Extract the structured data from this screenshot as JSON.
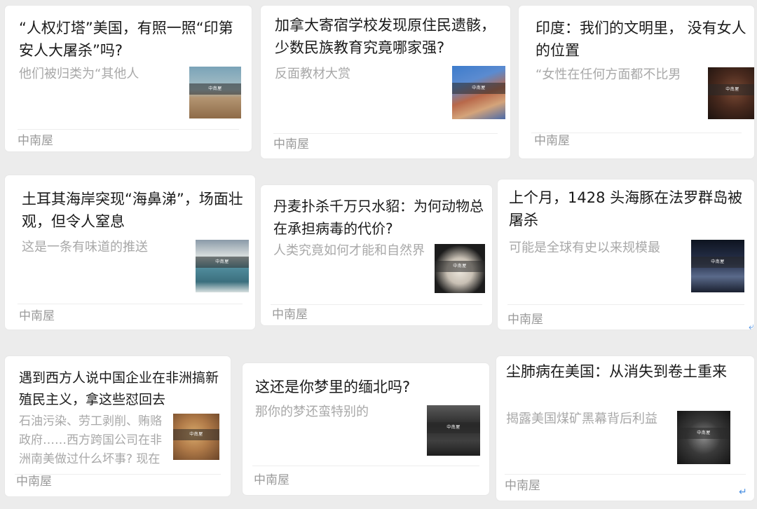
{
  "cards": [
    {
      "title": "“人权灯塔”美国，有照一照“印第安人大屠杀”吗?",
      "summary": "他们被归类为“其他人",
      "source": "中南屋",
      "thumb_icon": "desert-photo",
      "thumb_colors": [
        "#8fb3c3",
        "#b89a72"
      ]
    },
    {
      "title": "加拿大寄宿学校发现原住民遗骸，少数民族教育究竟哪家强?",
      "summary": "反面教材大赏",
      "source": "中南屋",
      "thumb_icon": "indigenous-portrait-photo",
      "thumb_colors": [
        "#3a78c8",
        "#c06a4a"
      ]
    },
    {
      "title": "印度：我们的文明里， 没有女人的位置",
      "summary": "“女性在任何方面都不比男",
      "source": "中南屋",
      "thumb_icon": "woman-face-photo",
      "thumb_colors": [
        "#2b1b14",
        "#6b4030"
      ]
    },
    {
      "title": "土耳其海岸突现“海鼻涕”，场面壮观，但令人窒息",
      "summary": "这是一条有味道的推送",
      "source": "中南屋",
      "thumb_icon": "coastline-photo",
      "thumb_colors": [
        "#4f8a9a",
        "#d8e0e0"
      ]
    },
    {
      "title": "丹麦扑杀千万只水貂：为何动物总在承担病毒的代价?",
      "summary": "人类究竟如何才能和自然界",
      "source": "中南屋",
      "thumb_icon": "mink-photo",
      "thumb_colors": [
        "#1c1c1c",
        "#e8e2d8"
      ]
    },
    {
      "title": "上个月，1428 头海豚在法罗群岛被屠杀",
      "summary": "可能是全球有史以来规模最",
      "source": "中南屋",
      "thumb_icon": "dolphins-night-photo",
      "thumb_colors": [
        "#141c2c",
        "#5a6a8a"
      ]
    },
    {
      "title": "遇到西方人说中国企业在非洲搞新殖民主义，拿这些怼回去",
      "summary": "石油污染、劳工剥削、贿赂政府……西方跨国公司在非洲南美做过什么坏事? 现在",
      "source": "中南屋",
      "thumb_icon": "crying-child-photo",
      "thumb_colors": [
        "#c89a5a",
        "#7a5030"
      ]
    },
    {
      "title": "这还是你梦里的缅北吗?",
      "summary": "那你的梦还蛮特别的",
      "source": "中南屋",
      "thumb_icon": "soldiers-photo",
      "thumb_colors": [
        "#2a2a2a",
        "#6a6a6a"
      ]
    },
    {
      "title": "尘肺病在美国：从消失到卷土重来",
      "summary": "揭露美国煤矿黑幕背后利益",
      "source": "中南屋",
      "thumb_icon": "coal-hands-photo",
      "thumb_colors": [
        "#181818",
        "#8a8a8a"
      ]
    }
  ],
  "watermark_text": "中南屋",
  "edge_icons": [
    "return-arrow-icon",
    "return-arrow-icon"
  ]
}
